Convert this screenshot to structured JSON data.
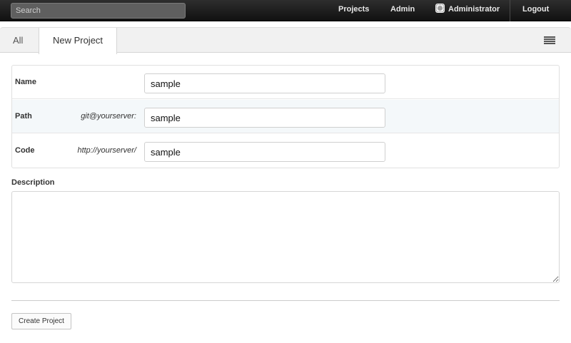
{
  "navbar": {
    "search_placeholder": "Search",
    "links": {
      "projects": "Projects",
      "admin": "Admin",
      "user": "Administrator",
      "logout": "Logout"
    }
  },
  "tabs": {
    "all": "All",
    "new_project": "New Project",
    "active": "New Project"
  },
  "form": {
    "name": {
      "label": "Name",
      "prefix": "",
      "value": "sample"
    },
    "path": {
      "label": "Path",
      "prefix": "git@yourserver:",
      "value": "sample"
    },
    "code": {
      "label": "Code",
      "prefix": "http://yourserver/",
      "value": "sample"
    },
    "description": {
      "label": "Description",
      "value": ""
    },
    "submit_label": "Create Project"
  },
  "colors": {
    "navbar": "#1c1c1c",
    "row_highlight": "#f4f8fa"
  },
  "icons": [
    "user-icon",
    "list-view-icon"
  ]
}
